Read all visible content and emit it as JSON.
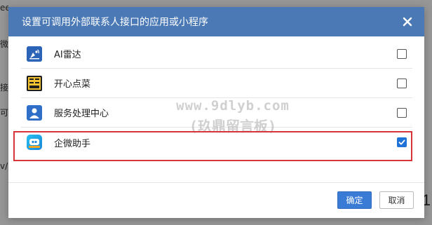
{
  "dialog": {
    "title": "设置可调用外部联系人接口的应用或小程序",
    "close_label": "✕"
  },
  "apps": [
    {
      "name": "AI雷达",
      "icon": "radar-icon",
      "color": "#2b63b7",
      "checked": false
    },
    {
      "name": "开心点菜",
      "icon": "menu-order-icon",
      "color": "#1e1e1e",
      "checked": false
    },
    {
      "name": "服务处理中心",
      "icon": "service-center-icon",
      "color": "#2f6fc8",
      "checked": false
    },
    {
      "name": "企微助手",
      "icon": "wecom-assistant-icon",
      "color": "#1fa3e8",
      "checked": true
    }
  ],
  "watermark": {
    "line1": "www.9dlyb.com",
    "line2": "(玖鼎留言板)"
  },
  "footer": {
    "confirm_label": "确定",
    "cancel_label": "取消"
  },
  "background": {
    "fragments": [
      "ee",
      "微",
      "接",
      "可i",
      "v/多"
    ],
    "right_number": "1"
  },
  "colors": {
    "header": "#4a79b5",
    "highlight": "#d9343a",
    "primary": "#3a7bd5",
    "checkbox_checked": "#1f72d6"
  }
}
